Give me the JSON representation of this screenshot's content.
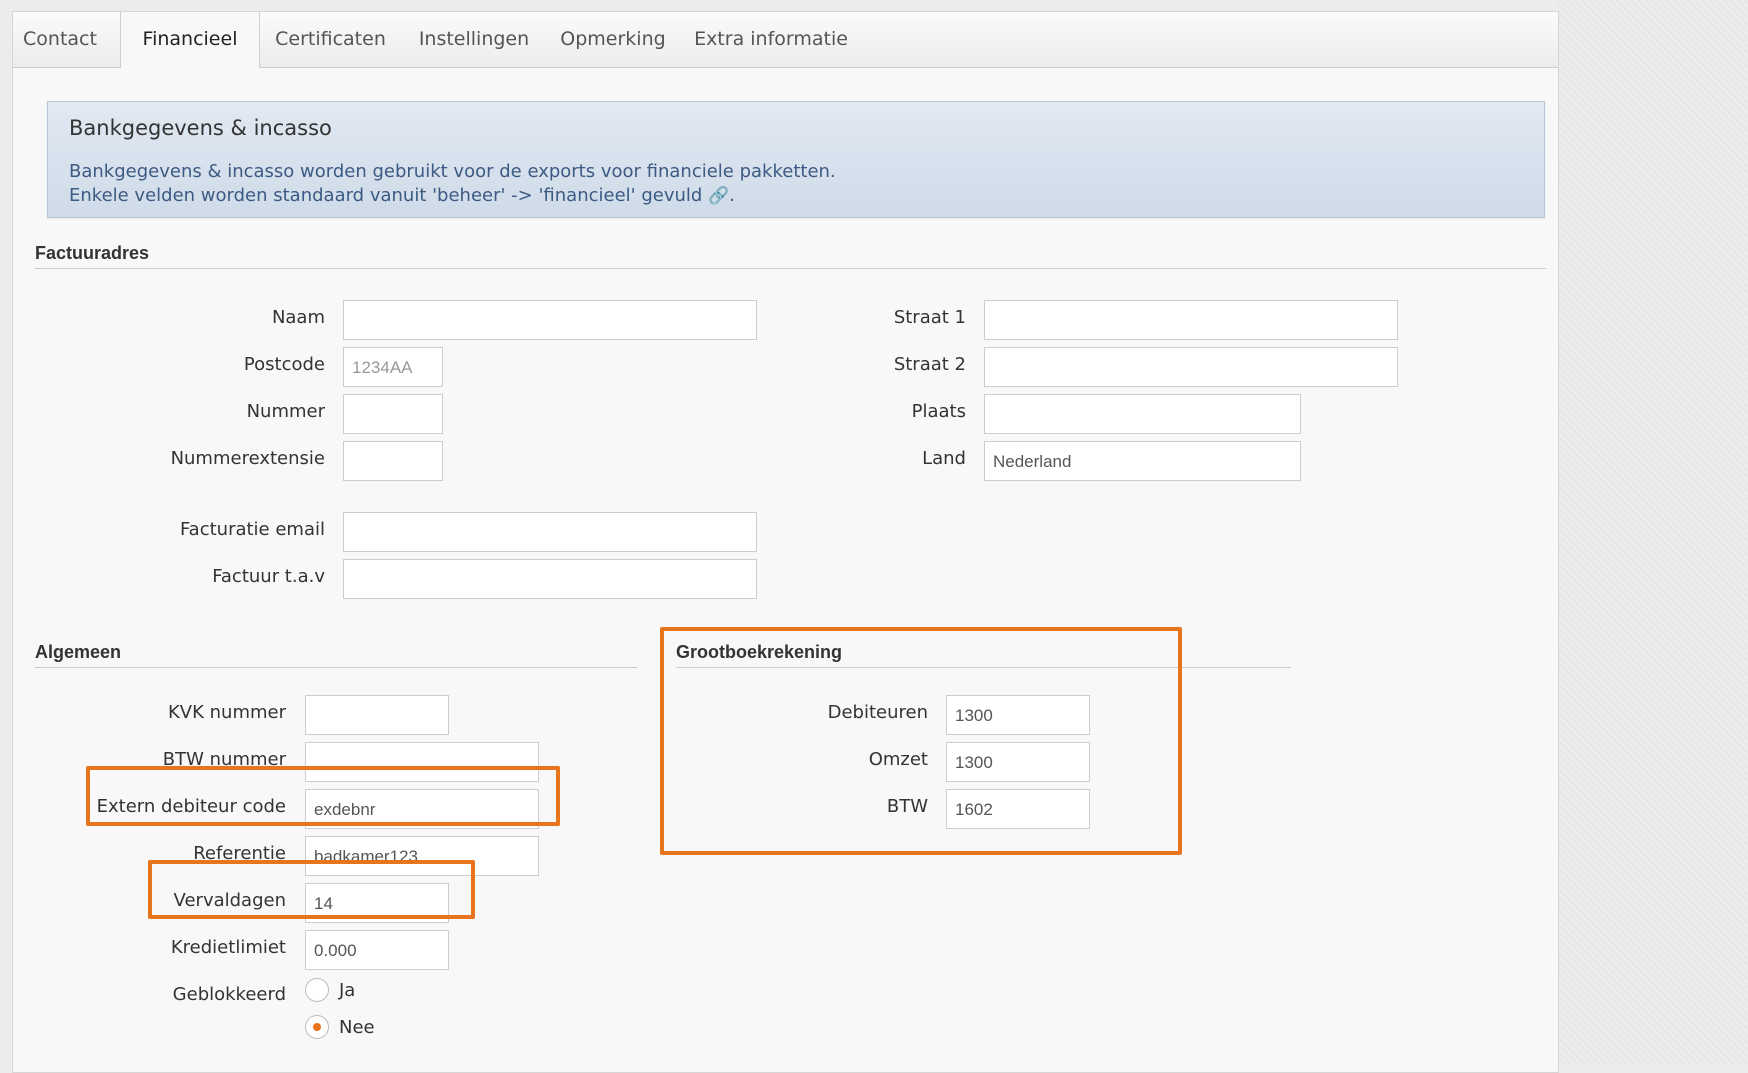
{
  "tabs": [
    {
      "label": "Contact"
    },
    {
      "label": "Financieel"
    },
    {
      "label": "Certificaten"
    },
    {
      "label": "Instellingen"
    },
    {
      "label": "Opmerking"
    },
    {
      "label": "Extra informatie"
    }
  ],
  "active_tab": "Financieel",
  "info": {
    "title": "Bankgegevens & incasso",
    "line1": "Bankgegevens & incasso worden gebruikt voor de exports voor financiele pakketten.",
    "line2": "Enkele velden worden standaard vanuit 'beheer' -> 'financieel' gevuld",
    "line2_end": "."
  },
  "factuuradres": {
    "title": "Factuuradres",
    "naam": {
      "label": "Naam",
      "value": ""
    },
    "postcode": {
      "label": "Postcode",
      "value": "",
      "placeholder": "1234AA"
    },
    "nummer": {
      "label": "Nummer",
      "value": ""
    },
    "nummerextensie": {
      "label": "Nummerextensie",
      "value": ""
    },
    "facturatie_email": {
      "label": "Facturatie email",
      "value": ""
    },
    "factuur_tav": {
      "label": "Factuur t.a.v",
      "value": ""
    },
    "straat1": {
      "label": "Straat 1",
      "value": ""
    },
    "straat2": {
      "label": "Straat 2",
      "value": ""
    },
    "plaats": {
      "label": "Plaats",
      "value": ""
    },
    "land": {
      "label": "Land",
      "value": "Nederland"
    }
  },
  "algemeen": {
    "title": "Algemeen",
    "kvk": {
      "label": "KVK nummer",
      "value": ""
    },
    "btw": {
      "label": "BTW nummer",
      "value": ""
    },
    "extern_debiteur": {
      "label": "Extern debiteur code",
      "value": "exdebnr"
    },
    "referentie": {
      "label": "Referentie",
      "value": "badkamer123"
    },
    "vervaldagen": {
      "label": "Vervaldagen",
      "value": "14"
    },
    "kredietlimiet": {
      "label": "Kredietlimiet",
      "value": "0.000"
    },
    "geblokkeerd": {
      "label": "Geblokkeerd",
      "options": [
        "Ja",
        "Nee"
      ],
      "selected": "Nee"
    }
  },
  "grootboek": {
    "title": "Grootboekrekening",
    "debiteuren": {
      "label": "Debiteuren",
      "value": "1300"
    },
    "omzet": {
      "label": "Omzet",
      "value": "1300"
    },
    "btw": {
      "label": "BTW",
      "value": "1602"
    }
  },
  "colors": {
    "highlight": "#e8741e",
    "info_bg": "#d7e2ee",
    "info_text": "#3c5a82"
  }
}
